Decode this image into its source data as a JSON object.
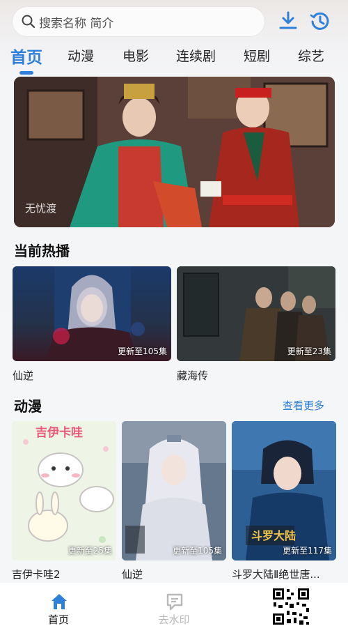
{
  "search": {
    "placeholder": "搜索名称 简介"
  },
  "tabs": [
    "首页",
    "动漫",
    "电影",
    "连续剧",
    "短剧",
    "综艺"
  ],
  "banner": {
    "watermark": "无忧渡"
  },
  "hot": {
    "title": "当前热播",
    "items": [
      {
        "title": "仙逆",
        "badge": "更新至105集"
      },
      {
        "title": "藏海传",
        "badge": "更新至23集"
      }
    ]
  },
  "anime": {
    "title": "动漫",
    "more": "查看更多",
    "items": [
      {
        "title": "吉伊卡哇2",
        "badge": "更新至25集",
        "poster_text": "吉伊卡哇"
      },
      {
        "title": "仙逆",
        "badge": "更新至105集"
      },
      {
        "title": "斗罗大陆Ⅱ绝世唐...",
        "badge": "更新至117集"
      }
    ]
  },
  "nav": {
    "home": "首页",
    "watermark": "去水印"
  },
  "colors": {
    "accent": "#2f80d8",
    "nav_inactive": "#b8b8b8"
  }
}
